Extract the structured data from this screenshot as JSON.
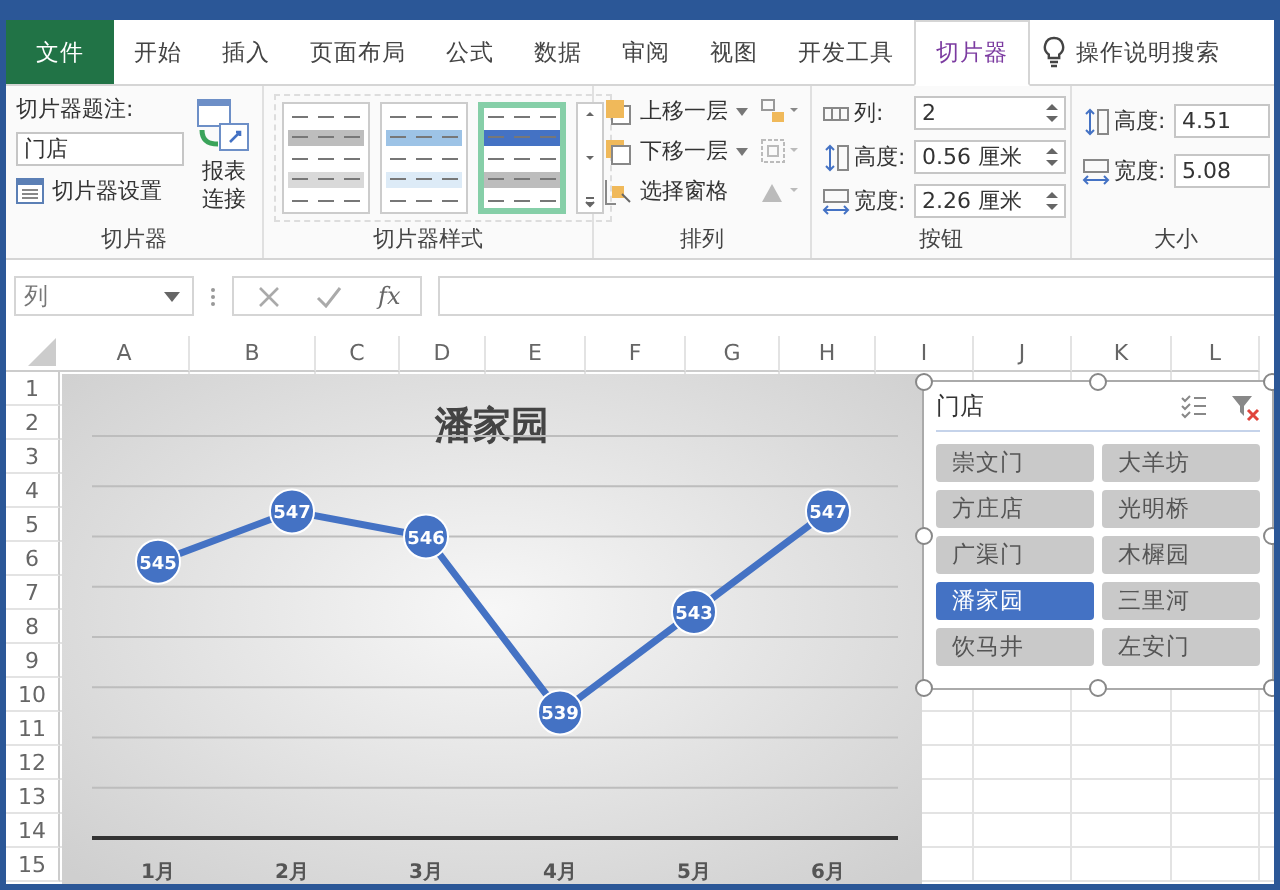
{
  "tabs": [
    {
      "label": "文件",
      "kind": "file",
      "selected": false
    },
    {
      "label": "开始",
      "kind": "tab",
      "selected": false
    },
    {
      "label": "插入",
      "kind": "tab",
      "selected": false
    },
    {
      "label": "页面布局",
      "kind": "tab",
      "selected": false
    },
    {
      "label": "公式",
      "kind": "tab",
      "selected": false
    },
    {
      "label": "数据",
      "kind": "tab",
      "selected": false
    },
    {
      "label": "审阅",
      "kind": "tab",
      "selected": false
    },
    {
      "label": "视图",
      "kind": "tab",
      "selected": false
    },
    {
      "label": "开发工具",
      "kind": "tab",
      "selected": false
    },
    {
      "label": "切片器",
      "kind": "tab",
      "selected": true
    }
  ],
  "tell_me": "操作说明搜索",
  "ribbon": {
    "slicer_group": {
      "caption_label": "切片器题注:",
      "caption_value": "门店",
      "settings_button": "切片器设置",
      "report_connections": "报表连接",
      "label": "切片器"
    },
    "styles_group": {
      "label": "切片器样式",
      "styles": [
        {
          "selected": false
        },
        {
          "selected": false
        },
        {
          "selected": true
        }
      ]
    },
    "arrange_group": {
      "label": "排列",
      "bring_forward": "上移一层",
      "send_backward": "下移一层",
      "selection_pane": "选择窗格"
    },
    "buttons_group": {
      "label": "按钮",
      "columns_label": "列:",
      "columns_value": "2",
      "height_label": "高度:",
      "height_value": "0.56 厘米",
      "width_label": "宽度:",
      "width_value": "2.26 厘米"
    },
    "size_group": {
      "label": "大小",
      "height_label": "高度:",
      "height_value": "4.51",
      "width_label": "宽度:",
      "width_value": "5.08"
    }
  },
  "formula_bar": {
    "name_box": "列",
    "fx_label": "fx"
  },
  "sheet": {
    "columns": [
      "A",
      "B",
      "C",
      "D",
      "E",
      "F",
      "G",
      "H",
      "I",
      "J",
      "K",
      "L"
    ],
    "rows": [
      "1",
      "2",
      "3",
      "4",
      "5",
      "6",
      "7",
      "8",
      "9",
      "10",
      "11",
      "12",
      "13",
      "14",
      "15"
    ]
  },
  "chart": {
    "chart_data": {
      "type": "line",
      "title": "潘家园",
      "categories": [
        "1月",
        "2月",
        "3月",
        "4月",
        "5月",
        "6月"
      ],
      "values": [
        545,
        547,
        546,
        539,
        543,
        547
      ],
      "ylim": [
        534,
        550
      ],
      "marker": true,
      "data_labels": true
    }
  },
  "slicer": {
    "title": "门店",
    "items": [
      {
        "label": "崇文门",
        "selected": false
      },
      {
        "label": "大羊坊",
        "selected": false
      },
      {
        "label": "方庄店",
        "selected": false
      },
      {
        "label": "光明桥",
        "selected": false
      },
      {
        "label": "广渠门",
        "selected": false
      },
      {
        "label": "木樨园",
        "selected": false
      },
      {
        "label": "潘家园",
        "selected": true
      },
      {
        "label": "三里河",
        "selected": false
      },
      {
        "label": "饮马井",
        "selected": false
      },
      {
        "label": "左安门",
        "selected": false
      }
    ]
  }
}
